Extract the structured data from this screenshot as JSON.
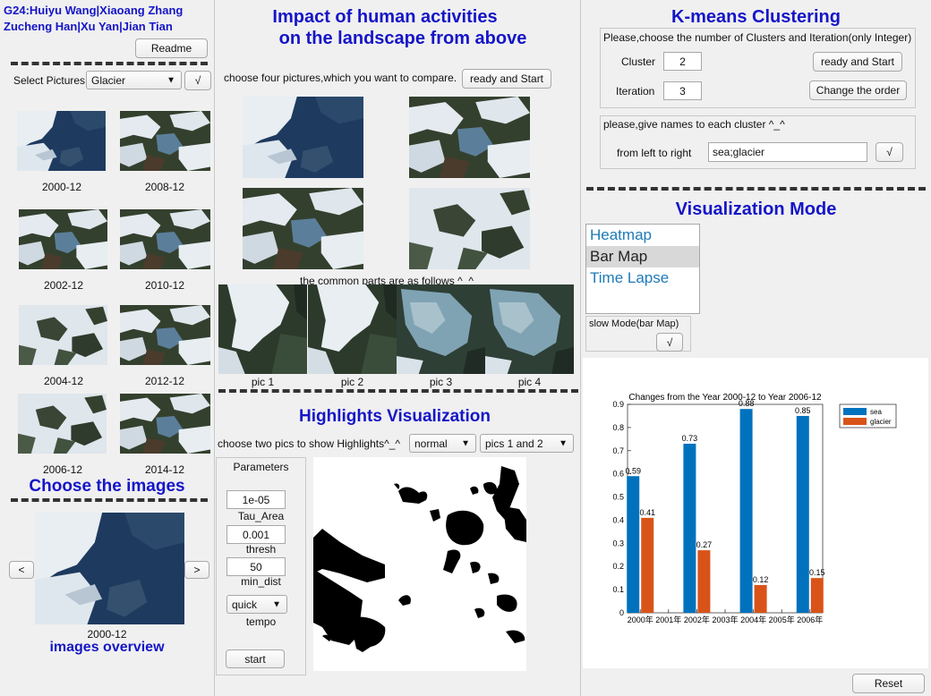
{
  "authors": {
    "line1": "G24:Huiyu Wang|Xiaoang Zhang",
    "line2": "Zucheng Han|Xu Yan|Jian Tian"
  },
  "left": {
    "readme_label": "Readme",
    "select_label": "Select Pictures",
    "select_value": "Glacier",
    "check_glyph": "√",
    "thumbnails": [
      {
        "label": "2000-12"
      },
      {
        "label": "2008-12"
      },
      {
        "label": "2002-12"
      },
      {
        "label": "2010-12"
      },
      {
        "label": "2004-12"
      },
      {
        "label": "2012-12"
      },
      {
        "label": "2006-12"
      },
      {
        "label": "2014-12"
      }
    ],
    "choose_title": "Choose the images",
    "prev_label": "<",
    "next_label": ">",
    "preview_label": "2000-12",
    "overview_title": "images overview"
  },
  "middle": {
    "title_line1": "Impact of human activities",
    "title_line2": "on the landscape from above",
    "instruction": "choose four pictures,which you want to compare.",
    "ready_label": "ready and Start",
    "common_text": "the common parts are as follows ^_^",
    "pics": [
      "pic 1",
      "pic 2",
      "pic 3",
      "pic 4"
    ],
    "highlights_title": "Highlights Visualization",
    "highlights_instruction": "choose two pics to show Highlights^_^",
    "mode_value": "normal",
    "pics_value": "pics 1 and 2",
    "params_title": "Parameters",
    "tau_value": "1e-05",
    "tau_label": "Tau_Area",
    "thresh_value": "0.001",
    "thresh_label": "thresh",
    "mindist_value": "50",
    "mindist_label": "min_dist",
    "tempo_value": "quick",
    "tempo_label": "tempo",
    "start_label": "start"
  },
  "right": {
    "kmeans_title": "K-means Clustering",
    "kmeans_instruction": "Please,choose the number of Clusters and Iteration(only Integer)",
    "cluster_label": "Cluster",
    "cluster_value": "2",
    "iteration_label": "Iteration",
    "iteration_value": "3",
    "ready_label": "ready and Start",
    "change_order_label": "Change the order",
    "names_instruction": "please,give names to each cluster ^_^",
    "from_left_label": "from left to right",
    "names_value": "sea;glacier",
    "check_glyph": "√",
    "viz_title": "Visualization Mode",
    "viz_modes": [
      "Heatmap",
      "Bar Map",
      "Time Lapse"
    ],
    "viz_selected": "Bar Map",
    "slow_mode_label": "slow Mode(bar Map)",
    "reset_label": "Reset"
  },
  "colors": {
    "title_blue": "#1515c8",
    "sea": "#0072bd",
    "glacier": "#d95319",
    "list_blue": "#1e7ab8"
  },
  "chart_data": {
    "type": "bar",
    "title": "Changes from the Year 2000-12 to Year 2006-12",
    "x_ticks": [
      "2000年",
      "2001年",
      "2002年",
      "2003年",
      "2004年",
      "2005年",
      "2006年"
    ],
    "x": [
      2000,
      2002,
      2004,
      2006
    ],
    "series": [
      {
        "name": "sea",
        "values": [
          0.59,
          0.73,
          0.88,
          0.85
        ]
      },
      {
        "name": "glacier",
        "values": [
          0.41,
          0.27,
          0.12,
          0.15
        ]
      }
    ],
    "ylim": [
      0,
      0.9
    ],
    "yticks": [
      0,
      0.1,
      0.2,
      0.3,
      0.4,
      0.5,
      0.6,
      0.7,
      0.8,
      0.9
    ],
    "legend": "top-right",
    "grid": false
  }
}
